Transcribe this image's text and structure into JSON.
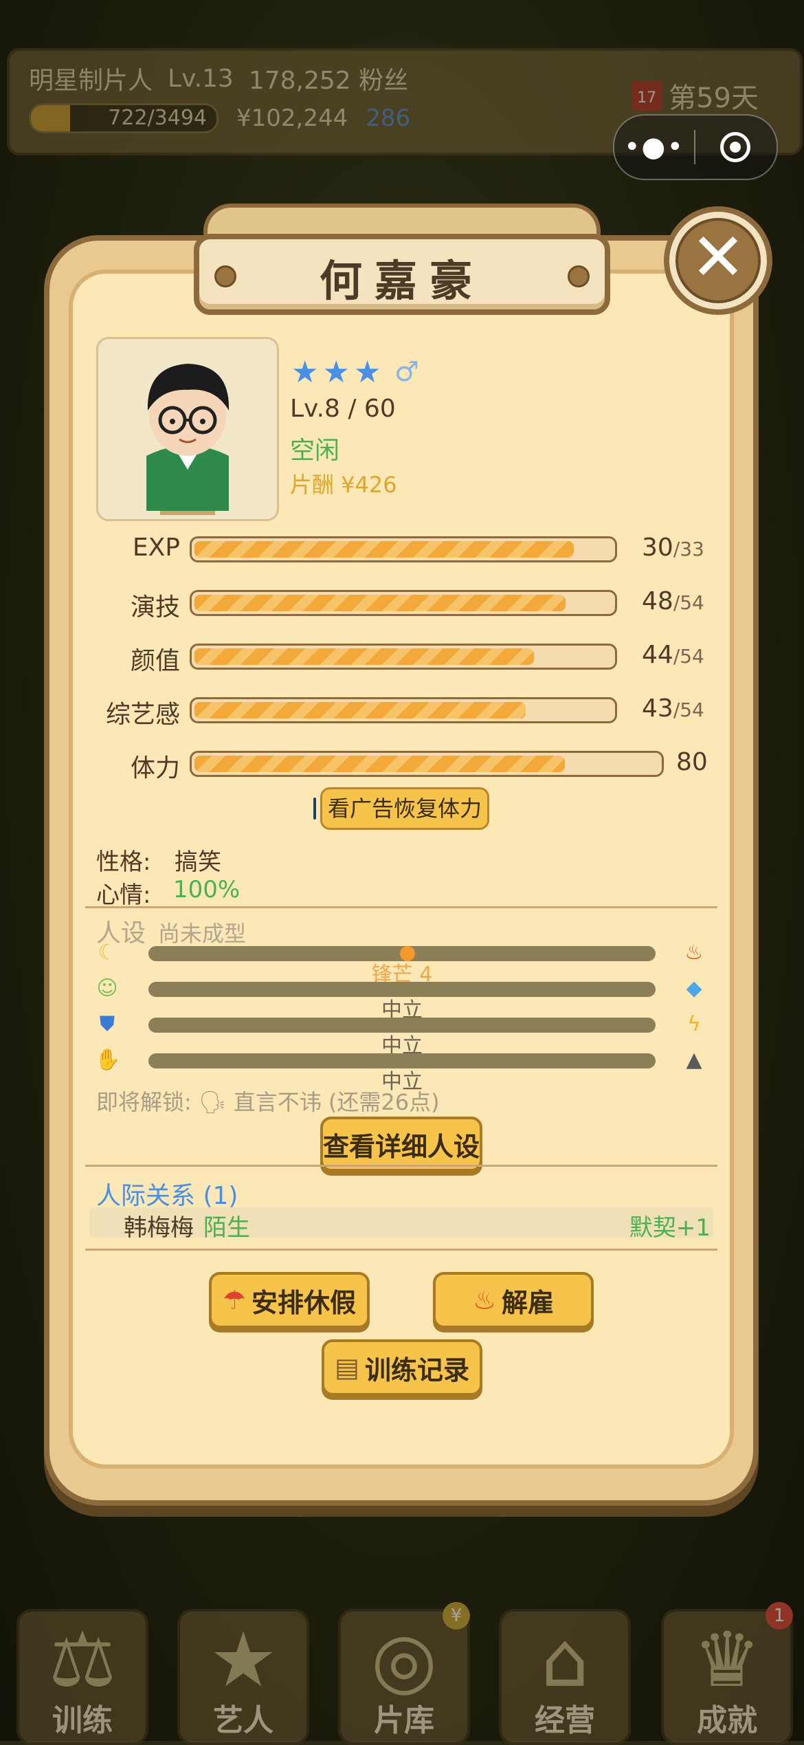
{
  "hud": {
    "title": "明星制片人",
    "level": "Lv.13",
    "fans": "178,252 粉丝",
    "exp": "722/3494",
    "exp_fraction": 0.21,
    "money": "¥102,244",
    "diamonds": "286",
    "calendar_day": "17",
    "day": "第59天"
  },
  "capsule": {
    "more_icon": "•●•",
    "close_icon": "target-icon"
  },
  "modal": {
    "title": "何嘉豪",
    "close_glyph": "✕",
    "stars": "★★★",
    "gender": "♂",
    "level": "Lv.8 / 60",
    "status": "空闲",
    "salary": "片酬 ¥426",
    "stats": [
      {
        "label": "EXP",
        "value": "30",
        "max": "/33",
        "fraction": 0.909
      },
      {
        "label": "演技",
        "value": "48",
        "max": "/54",
        "fraction": 0.889
      },
      {
        "label": "颜值",
        "value": "44",
        "max": "/54",
        "fraction": 0.815
      },
      {
        "label": "综艺感",
        "value": "43",
        "max": "/54",
        "fraction": 0.796
      }
    ],
    "stamina": {
      "label": "体力",
      "value": "80",
      "fraction": 0.8
    },
    "ad_button": "看广告恢复体力",
    "personality_label": "性格:",
    "personality_value": "搞笑",
    "mood_label": "心情:",
    "mood_value": "100%",
    "persona_title": "人设",
    "persona_sub": "尚未成型",
    "persona_rows": [
      {
        "label": "锋芒 4",
        "left_icon": "moon-icon",
        "right_icon": "fire-icon"
      },
      {
        "label": "中立",
        "left_icon": "mask-icon",
        "right_icon": "diamond-icon"
      },
      {
        "label": "中立",
        "left_icon": "shield-icon",
        "right_icon": "lightning-icon"
      },
      {
        "label": "中立",
        "left_icon": "handshake-icon",
        "right_icon": "eagle-icon"
      }
    ],
    "unlock_text": "即将解锁: 🗣 直言不讳 (还需26点)",
    "persona_button": "查看详细人设",
    "relations_title": "人际关系 (1)",
    "relations": [
      {
        "name": "韩梅梅",
        "state": "陌生",
        "bonus": "默契+1"
      }
    ],
    "vacation_button": "安排休假",
    "fire_button": "解雇",
    "training_button": "训练记录"
  },
  "nav": [
    {
      "label": "训练",
      "icon": "dumbbell-icon"
    },
    {
      "label": "艺人",
      "icon": "star-trophy-icon"
    },
    {
      "label": "片库",
      "icon": "film-reel-icon",
      "badge": "¥"
    },
    {
      "label": "经营",
      "icon": "shop-icon"
    },
    {
      "label": "成就",
      "icon": "trophy-icon",
      "badge": "1"
    }
  ]
}
